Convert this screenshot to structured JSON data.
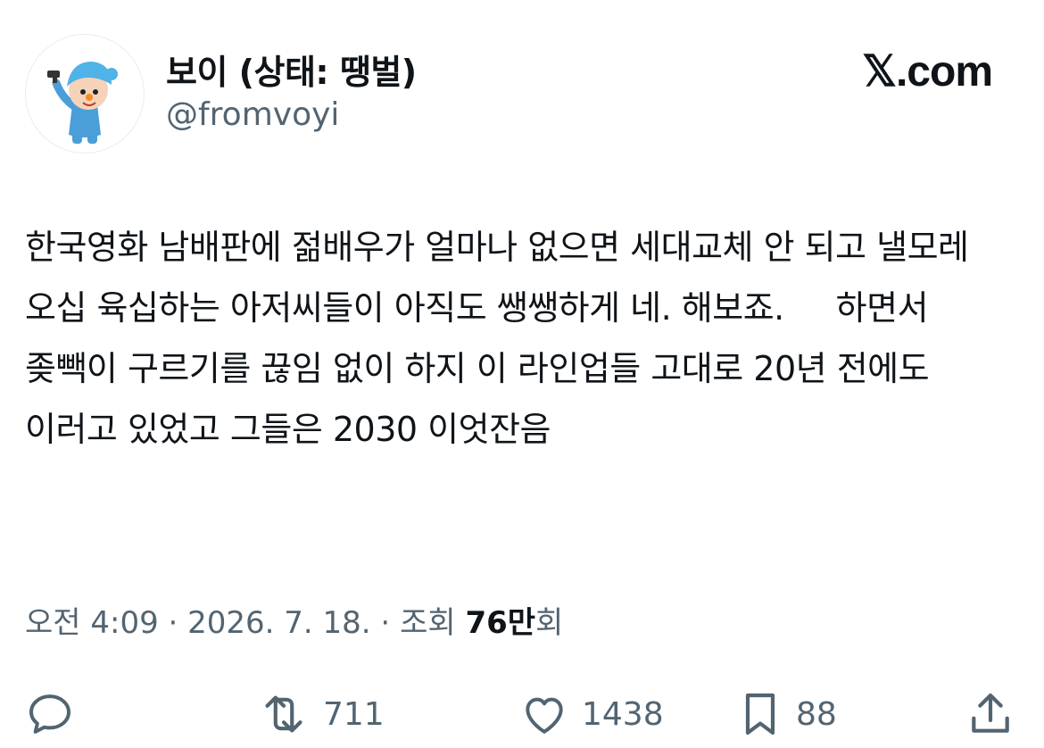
{
  "user": {
    "display_name": "보이 (상태: 땡벌)",
    "handle": "@fromvoyi",
    "avatar_icon": "pocoyo-avatar-icon"
  },
  "brand": {
    "label": "𝕏.com"
  },
  "post": {
    "text": "한국영화 남배판에 젊배우가 얼마나 없으면 세대교체 안 되고 낼모레 오십 육십하는 아저씨들이 아직도 쌩쌩하게 네. 해보죠.     하면서 좆빽이 구르기를 끊임 없이 하지 이 라인업들 고대로 20년 전에도 이러고 있었고 그들은 2030 이엇잔음"
  },
  "meta": {
    "time": "오전 4:09",
    "separator1": " · ",
    "date": "2026. 7. 18.",
    "separator2": " · ",
    "views_prefix": "조회 ",
    "views_count": "76만",
    "views_suffix": "회"
  },
  "actions": {
    "reply_icon": "reply-icon",
    "retweet_icon": "retweet-icon",
    "retweet_count": "711",
    "like_icon": "heart-icon",
    "like_count": "1438",
    "bookmark_icon": "bookmark-icon",
    "bookmark_count": "88",
    "share_icon": "share-icon"
  },
  "colors": {
    "text_primary": "#0f1419",
    "text_secondary": "#536471",
    "background": "#ffffff"
  }
}
